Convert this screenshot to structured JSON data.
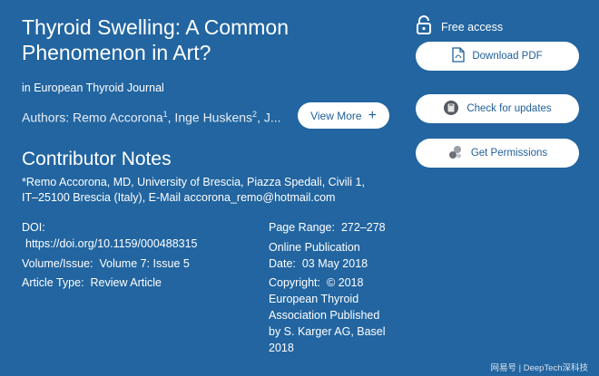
{
  "article": {
    "title": "Thyroid Swelling: A Common Phenomenon in Art?",
    "journal": "in European Thyroid Journal",
    "authors_prefix": "Authors: Remo Accorona",
    "author1_sup": "1",
    "author2": ", Inge Huskens",
    "author2_sup": "2",
    "authors_suffix": ", J..."
  },
  "buttons": {
    "view_more": "View More",
    "download_pdf": "Download PDF",
    "check_updates": "Check for updates",
    "get_permissions": "Get Permissions"
  },
  "access": {
    "label": "Free access"
  },
  "contributor": {
    "heading": "Contributor Notes",
    "line1": "*Remo Accorona, MD, University of Brescia, Piazza Spedali, Civili 1,",
    "line2": "IT–25100 Brescia (Italy), E-Mail accorona_remo@hotmail.com"
  },
  "meta": {
    "doi_label": "DOI:",
    "doi_value": "https://doi.org/10.1159/000488315",
    "volume_label": "Volume/Issue:",
    "volume_value": "Volume 7: Issue 5",
    "type_label": "Article Type:",
    "type_value": "Review Article",
    "page_range_label": "Page Range:",
    "page_range_value": "272–278",
    "online_pub_line1": "Online Publication",
    "online_pub_label": "Date:",
    "online_pub_value": "03 May 2018",
    "copyright_label": "Copyright:",
    "copyright_value": "© 2018",
    "copyright_lines": [
      "European Thyroid",
      "Association Published",
      "by S. Karger AG, Basel",
      "2018"
    ]
  },
  "watermark": "网易号 | DeepTech深科技",
  "icons": [
    "lock-open-icon",
    "pdf-file-icon",
    "crossmark-icon",
    "permissions-icon",
    "plus-icon"
  ],
  "colors": {
    "background": "#2265a0",
    "button_text": "#1f5f99",
    "button_bg": "#ffffff"
  }
}
